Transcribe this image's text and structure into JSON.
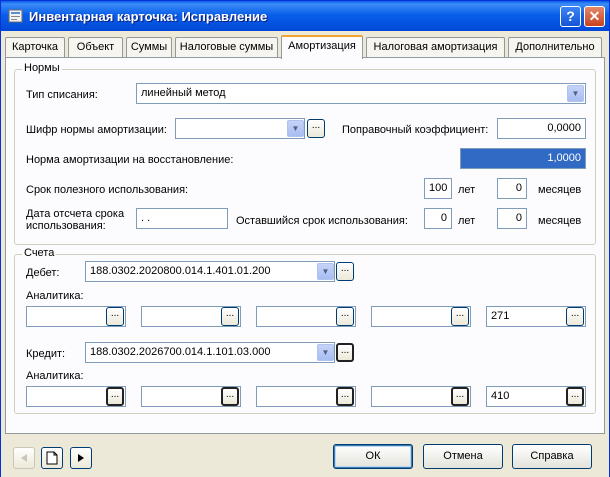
{
  "window": {
    "title": "Инвентарная карточка: Исправление",
    "help_button": "?",
    "close_button": "✕"
  },
  "tabs": [
    {
      "label": "Карточка"
    },
    {
      "label": "Объект"
    },
    {
      "label": "Суммы"
    },
    {
      "label": "Налоговые суммы"
    },
    {
      "label": "Амортизация",
      "active": true
    },
    {
      "label": "Налоговая амортизация"
    },
    {
      "label": "Дополнительно"
    }
  ],
  "norms": {
    "group_title": "Нормы",
    "writeoff_type_label": "Тип списания:",
    "writeoff_type_value": "линейный метод",
    "norm_code_label": "Шифр нормы амортизации:",
    "norm_code_value": "",
    "correction_label": "Поправочный коэффициент:",
    "correction_value": "0,0000",
    "restore_norm_label": "Норма амортизации на восстановление:",
    "restore_norm_value": "1,0000",
    "useful_life_label": "Срок полезного использования:",
    "useful_life_years": "100",
    "years_unit": "лет",
    "useful_life_months": "0",
    "months_unit": "месяцев",
    "start_date_label_line1": "Дата отсчета срока",
    "start_date_label_line2": "использования:",
    "start_date_value": " .  .",
    "remaining_label": "Оставшийся срок использования:",
    "remaining_years": "0",
    "remaining_months": "0"
  },
  "accounts": {
    "group_title": "Счета",
    "debit_label": "Дебет:",
    "debit_value": "188.0302.2020800.014.1.401.01.200",
    "debit_analytics_label": "Аналитика:",
    "debit_analytics": [
      "",
      "",
      "",
      "",
      "271"
    ],
    "credit_label": "Кредит:",
    "credit_value": "188.0302.2026700.014.1.101.03.000",
    "credit_analytics_label": "Аналитика:",
    "credit_analytics": [
      "",
      "",
      "",
      "",
      "410"
    ],
    "ellipsis": "..."
  },
  "footer": {
    "ok": "ОК",
    "cancel": "Отмена",
    "help": "Справка"
  }
}
